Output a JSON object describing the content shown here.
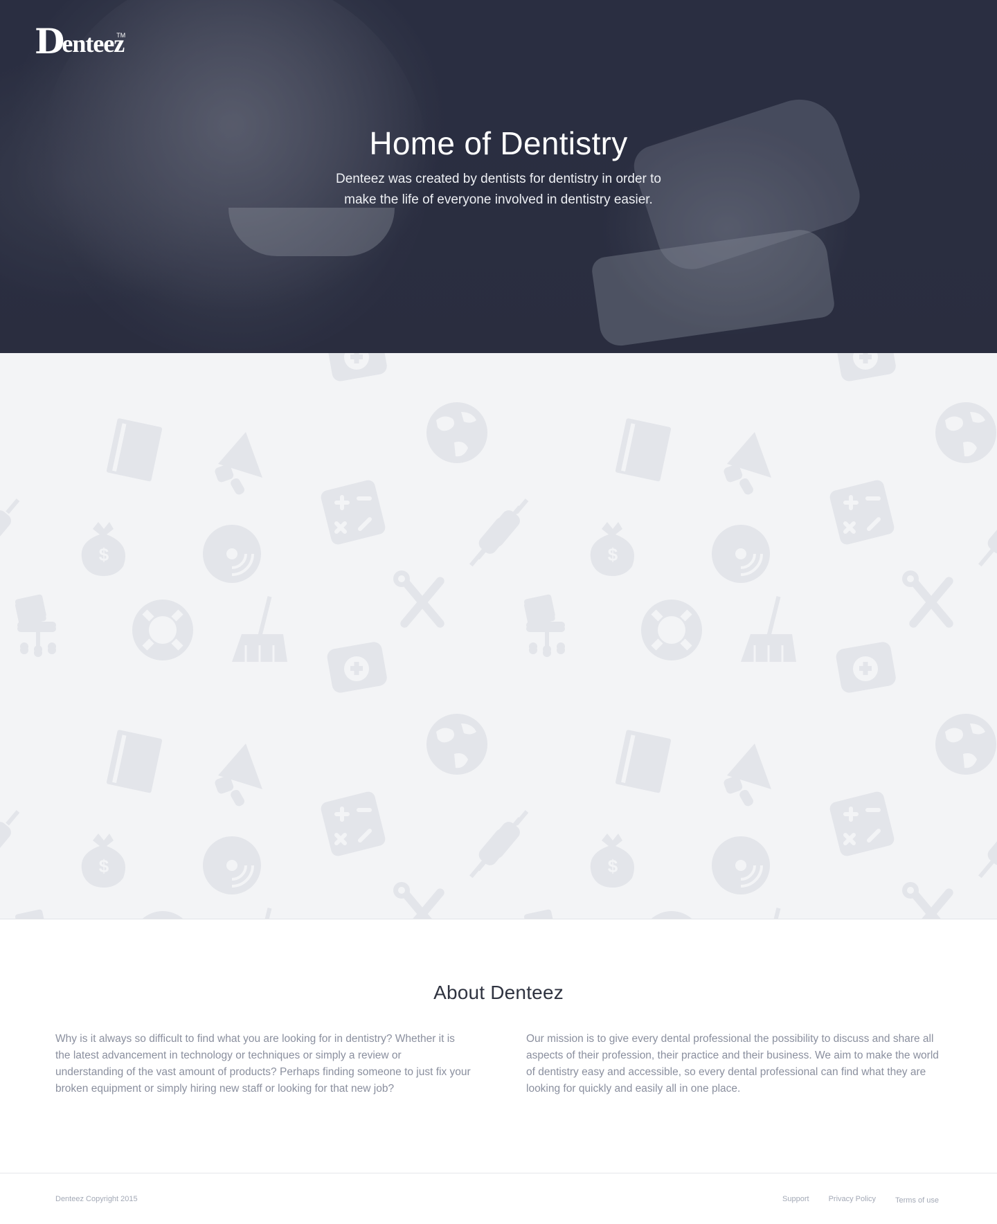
{
  "brand": {
    "logo_initial": "D",
    "logo_rest": "enteez",
    "logo_mark": "TM"
  },
  "hero": {
    "title": "Home of Dentistry",
    "subtitle": "Denteez was created by dentists for dentistry in order to make the life of everyone involved in dentistry easier."
  },
  "pattern": {
    "icons": [
      "office-chair-icon",
      "medical-kit-icon",
      "globe-icon",
      "book-icon",
      "megaphone-icon",
      "calculator-icon",
      "syringe-icon",
      "money-bag-icon",
      "disc-icon",
      "lifebuoy-icon",
      "broom-icon",
      "tools-icon"
    ]
  },
  "about": {
    "title": "About Denteez",
    "left_paragraph": "Why is it always so difficult to find what you are looking for in dentistry? Whether it is the latest advancement in technology or techniques or simply a review or understanding of the vast amount of products? Perhaps finding someone to just fix your broken equipment or simply hiring new staff or looking for that new job?",
    "right_paragraph": "Our mission is to give every dental professional the possibility to discuss and share all aspects of their profession, their practice and their business. We aim to make the world of dentistry easy and accessible, so every dental professional can find what they are looking for quickly and easily all in one place."
  },
  "footer": {
    "copyright": "Denteez Copyright 2015",
    "links": [
      "Support",
      "Privacy Policy",
      "Terms of use"
    ]
  },
  "colors": {
    "hero_overlay": "#2c3143",
    "pattern_bg": "#f3f4f6",
    "pattern_icon": "#e3e5ea",
    "body_text": "#8a8f9e",
    "heading": "#2f3340"
  }
}
